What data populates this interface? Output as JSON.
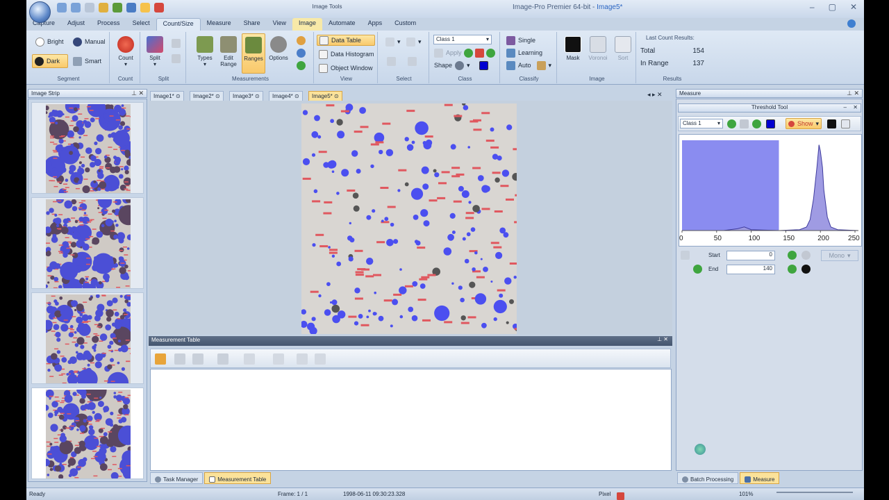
{
  "title": {
    "app": "Image-Pro Premier 64-bit - ",
    "document": "Image5*",
    "context_tab_group": "Image Tools"
  },
  "tabs": [
    "Capture",
    "Adjust",
    "Process",
    "Select",
    "Count/Size",
    "Measure",
    "Share",
    "View",
    "Image",
    "Automate",
    "Apps",
    "Custom"
  ],
  "active_tab": "Count/Size",
  "ribbon": {
    "segment": {
      "label": "Segment",
      "bright": "Bright",
      "manual": "Manual",
      "dark": "Dark",
      "smart": "Smart"
    },
    "count": {
      "label": "Count",
      "button": "Count"
    },
    "split": {
      "label": "Split",
      "button": "Split"
    },
    "measurements": {
      "label": "Measurements",
      "types": "Types",
      "edit_range": "Edit Range",
      "ranges": "Ranges",
      "options": "Options"
    },
    "view": {
      "label": "View",
      "data_table": "Data Table",
      "data_histogram": "Data Histogram",
      "object_window": "Object Window"
    },
    "select": {
      "label": "Select"
    },
    "class": {
      "label": "Class",
      "class_value": "Class 1",
      "apply": "Apply",
      "shape": "Shape"
    },
    "classify": {
      "label": "Classify",
      "single": "Single",
      "learning": "Learning",
      "auto": "Auto"
    },
    "image": {
      "label": "Image",
      "mask": "Mask",
      "voronoi": "Voronoi",
      "sort": "Sort"
    },
    "results": {
      "label": "Results",
      "title": "Last Count Results:",
      "total_label": "Total",
      "total_value": "154",
      "in_range_label": "In Range",
      "in_range_value": "137"
    }
  },
  "image_strip": {
    "title": "Image Strip"
  },
  "doc_tabs": [
    "Image1*",
    "Image2*",
    "Image3*",
    "Image4*",
    "Image5*"
  ],
  "measurement_table": {
    "title": "Measurement Table"
  },
  "bottom_tabs": {
    "task_manager": "Task Manager",
    "measurement_table": "Measurement Table",
    "batch_processing": "Batch Processing",
    "measure": "Measure"
  },
  "measure_panel": {
    "title": "Measure",
    "threshold_tool": "Threshold Tool",
    "class_value": "Class 1",
    "show": "Show",
    "start_label": "Start",
    "start_value": "0",
    "end_label": "End",
    "end_value": "140",
    "mono": "Mono"
  },
  "status": {
    "ready": "Ready",
    "frame": "Frame: 1 / 1",
    "timestamp": "1998-06-11 09:30:23.328",
    "unit": "Pixel",
    "zoom": "101%"
  },
  "chart_data": {
    "type": "area",
    "title": "",
    "xlabel": "",
    "ylabel": "",
    "xlim": [
      0,
      255
    ],
    "x_ticks": [
      "0",
      "50",
      "100",
      "150",
      "200",
      "250"
    ],
    "selected_range": [
      0,
      140
    ],
    "x": [
      0,
      60,
      80,
      90,
      100,
      140,
      170,
      180,
      185,
      190,
      195,
      198,
      200,
      203,
      205,
      210,
      215,
      225,
      255
    ],
    "values": [
      0,
      0,
      2,
      4,
      1,
      0,
      1,
      4,
      12,
      35,
      70,
      95,
      88,
      70,
      45,
      15,
      4,
      1,
      0
    ],
    "colors": {
      "fill": "#9f9be3",
      "selection": "#8a8cf0",
      "line": "#3e3b9e"
    }
  }
}
